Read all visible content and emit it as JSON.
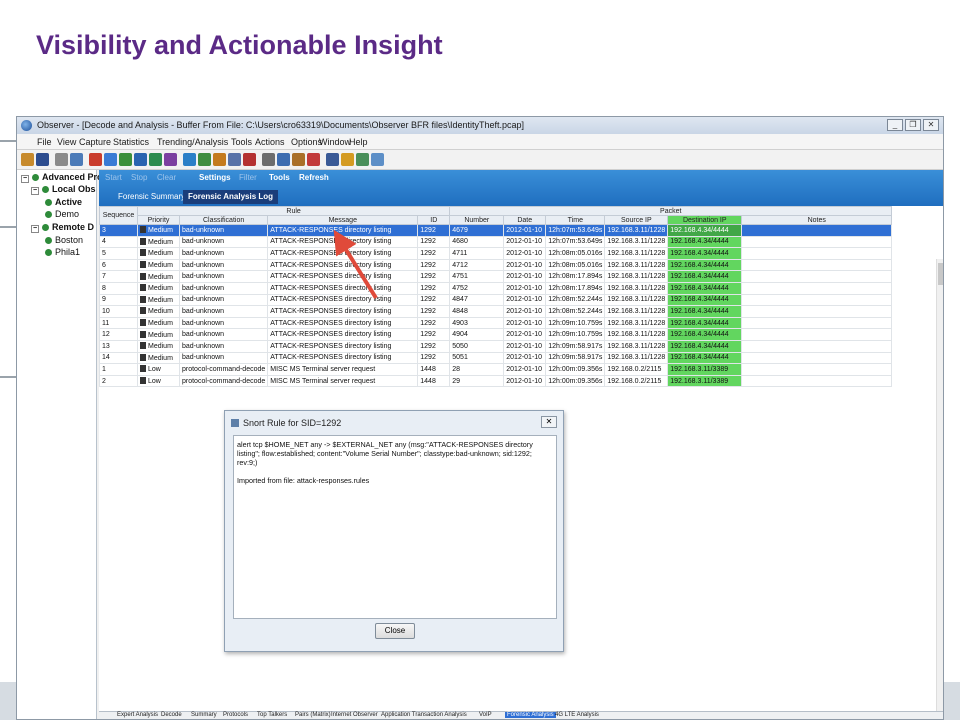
{
  "slide": {
    "title": "Visibility and  Actionable Insight"
  },
  "window": {
    "title": "Observer - [Decode and Analysis - Buffer From File: C:\\Users\\cro63319\\Documents\\Observer BFR files\\IdentityTheft.pcap]",
    "menu": [
      "File",
      "View",
      "Capture",
      "Statistics",
      "Trending/Analysis",
      "Tools",
      "Actions",
      "Options",
      "Window",
      "Help"
    ]
  },
  "tree": {
    "items": [
      {
        "label": "Advanced Pro",
        "bold": true
      },
      {
        "label": "Local Obs",
        "bold": true
      },
      {
        "label": "Active",
        "bold": true
      },
      {
        "label": "Demo",
        "bold": false
      },
      {
        "label": "Remote D",
        "bold": true
      },
      {
        "label": "Boston",
        "bold": false
      },
      {
        "label": "Phila1",
        "bold": false
      }
    ]
  },
  "toolbar2": {
    "items": [
      "Start",
      "Stop",
      "Clear",
      "Settings",
      "Filter",
      "Tools",
      "Refresh"
    ]
  },
  "tabs": [
    "Forensic Summary",
    "Forensic Analysis Log"
  ],
  "grid": {
    "group_headers": {
      "rule": "Rule",
      "packet": "Packet"
    },
    "columns": [
      "Sequence",
      "Priority",
      "Classification",
      "Message",
      "ID",
      "Number",
      "Date",
      "Time",
      "Source IP",
      "Destination IP",
      "Notes"
    ],
    "rows": [
      [
        "3",
        "Medium",
        "bad-unknown",
        "ATTACK-RESPONSES directory listing",
        "1292",
        "4679",
        "2012-01-10",
        "12h:07m:53.649s",
        "192.168.3.11/1228",
        "192.168.4.34/4444",
        ""
      ],
      [
        "4",
        "Medium",
        "bad-unknown",
        "ATTACK-RESPONSES directory listing",
        "1292",
        "4680",
        "2012-01-10",
        "12h:07m:53.649s",
        "192.168.3.11/1228",
        "192.168.4.34/4444",
        ""
      ],
      [
        "5",
        "Medium",
        "bad-unknown",
        "ATTACK-RESPONSES directory listing",
        "1292",
        "4711",
        "2012-01-10",
        "12h:08m:05.016s",
        "192.168.3.11/1228",
        "192.168.4.34/4444",
        ""
      ],
      [
        "6",
        "Medium",
        "bad-unknown",
        "ATTACK-RESPONSES directory listing",
        "1292",
        "4712",
        "2012-01-10",
        "12h:08m:05.016s",
        "192.168.3.11/1228",
        "192.168.4.34/4444",
        ""
      ],
      [
        "7",
        "Medium",
        "bad-unknown",
        "ATTACK-RESPONSES directory listing",
        "1292",
        "4751",
        "2012-01-10",
        "12h:08m:17.894s",
        "192.168.3.11/1228",
        "192.168.4.34/4444",
        ""
      ],
      [
        "8",
        "Medium",
        "bad-unknown",
        "ATTACK-RESPONSES directory listing",
        "1292",
        "4752",
        "2012-01-10",
        "12h:08m:17.894s",
        "192.168.3.11/1228",
        "192.168.4.34/4444",
        ""
      ],
      [
        "9",
        "Medium",
        "bad-unknown",
        "ATTACK-RESPONSES directory listing",
        "1292",
        "4847",
        "2012-01-10",
        "12h:08m:52.244s",
        "192.168.3.11/1228",
        "192.168.4.34/4444",
        ""
      ],
      [
        "10",
        "Medium",
        "bad-unknown",
        "ATTACK-RESPONSES directory listing",
        "1292",
        "4848",
        "2012-01-10",
        "12h:08m:52.244s",
        "192.168.3.11/1228",
        "192.168.4.34/4444",
        ""
      ],
      [
        "11",
        "Medium",
        "bad-unknown",
        "ATTACK-RESPONSES directory listing",
        "1292",
        "4903",
        "2012-01-10",
        "12h:09m:10.759s",
        "192.168.3.11/1228",
        "192.168.4.34/4444",
        ""
      ],
      [
        "12",
        "Medium",
        "bad-unknown",
        "ATTACK-RESPONSES directory listing",
        "1292",
        "4904",
        "2012-01-10",
        "12h:09m:10.759s",
        "192.168.3.11/1228",
        "192.168.4.34/4444",
        ""
      ],
      [
        "13",
        "Medium",
        "bad-unknown",
        "ATTACK-RESPONSES directory listing",
        "1292",
        "5050",
        "2012-01-10",
        "12h:09m:58.917s",
        "192.168.3.11/1228",
        "192.168.4.34/4444",
        ""
      ],
      [
        "14",
        "Medium",
        "bad-unknown",
        "ATTACK-RESPONSES directory listing",
        "1292",
        "5051",
        "2012-01-10",
        "12h:09m:58.917s",
        "192.168.3.11/1228",
        "192.168.4.34/4444",
        ""
      ],
      [
        "1",
        "Low",
        "protocol-command-decode",
        "MISC MS Terminal server request",
        "1448",
        "28",
        "2012-01-10",
        "12h:00m:09.356s",
        "192.168.0.2/2115",
        "192.168.3.11/3389",
        ""
      ],
      [
        "2",
        "Low",
        "protocol-command-decode",
        "MISC MS Terminal server request",
        "1448",
        "29",
        "2012-01-10",
        "12h:00m:09.356s",
        "192.168.0.2/2115",
        "192.168.3.11/3389",
        ""
      ]
    ]
  },
  "dialog": {
    "title": "Snort Rule for SID=1292",
    "rule_text": "alert tcp $HOME_NET any -> $EXTERNAL_NET any (msg:\"ATTACK-RESPONSES directory listing\"; flow:established; content:\"Volume Serial Number\"; classtype:bad-unknown; sid:1292; rev:9;)",
    "imported": "Imported from file: attack-responses.rules",
    "close_label": "Close"
  },
  "bottom_tabs": [
    "Expert Analysis",
    "Decode",
    "Summary",
    "Protocols",
    "Top Talkers",
    "Pairs (Matrix)",
    "Internet Observer",
    "Application Transaction Analysis",
    "VoIP",
    "Forensic Analysis",
    "4G LTE Analysis"
  ],
  "colors": {
    "title": "#5b2a86",
    "selected_row": "#2f6fd4",
    "dest_ip_highlight": "#62d65f",
    "blue_bar": "#2a7fd0"
  }
}
